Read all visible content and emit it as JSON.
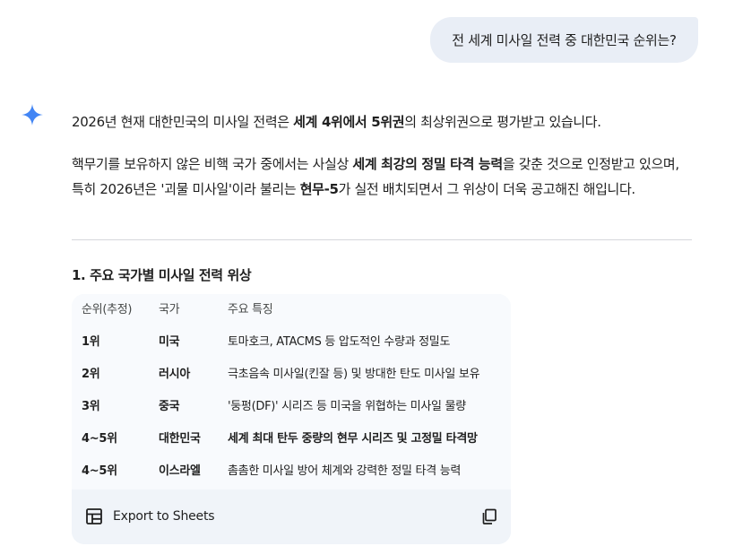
{
  "user_message": "전 세계 미사일 전력 중 대한민국 순위는?",
  "response": {
    "p1": {
      "a": "2026년 현재 대한민국의 미사일 전력은 ",
      "b": "세계 4위에서 5위권",
      "c": "의 최상위권으로 평가받고 있습니다."
    },
    "p2": {
      "a": "핵무기를 보유하지 않은 비핵 국가 중에서는 사실상 ",
      "b": "세계 최강의 정밀 타격 능력",
      "c": "을 갖춘 것으로 인정받고 있으며, 특히 2026년은 '괴물 미사일'이라 불리는 ",
      "d": "현무-5",
      "e": "가 실전 배치되면서 그 위상이 더욱 공고해진 해입니다."
    },
    "section_title": "1. 주요 국가별 미사일 전력 위상",
    "table": {
      "headers": [
        "순위(추정)",
        "국가",
        "주요 특징"
      ],
      "rows": [
        [
          "1위",
          "미국",
          "토마호크, ATACMS 등 압도적인 수량과 정밀도"
        ],
        [
          "2위",
          "러시아",
          "극초음속 미사일(킨잘 등) 및 방대한 탄도 미사일 보유"
        ],
        [
          "3위",
          "중국",
          "'둥펑(DF)' 시리즈 등 미국을 위협하는 미사일 물량"
        ],
        [
          "4~5위",
          "대한민국",
          "세계 최대 탄두 중량의 현무 시리즈 및 고정밀 타격망"
        ],
        [
          "4~5위",
          "이스라엘",
          "촘촘한 미사일 방어 체계와 강력한 정밀 타격 능력"
        ]
      ]
    },
    "export_label": "Export to Sheets",
    "icons": {
      "assistant": "sparkle-icon",
      "export": "table-icon",
      "copy": "copy-icon"
    },
    "colors": {
      "sparkle": "#4285f4",
      "user_bubble": "#e9eef6",
      "table_bg": "#f8fafd",
      "footer_bg": "#f0f4f9"
    }
  }
}
